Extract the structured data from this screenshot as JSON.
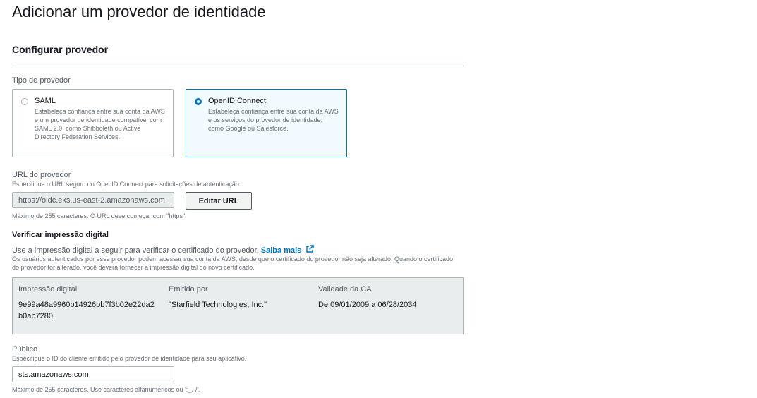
{
  "page": {
    "title": "Adicionar um provedor de identidade",
    "section_title": "Configurar provedor"
  },
  "provider_type": {
    "label": "Tipo de provedor",
    "options": [
      {
        "title": "SAML",
        "description": "Estabeleça confiança entre sua conta da AWS e um provedor de identidade compatível com SAML 2.0, como Shibboleth ou Active Directory Federation Services.",
        "selected": false
      },
      {
        "title": "OpenID Connect",
        "description": "Estabeleça confiança entre sua conta da AWS e os serviços do provedor de identidade, como Google ou Salesforce.",
        "selected": true
      }
    ]
  },
  "provider_url": {
    "label": "URL do provedor",
    "hint": "Especifique o URL seguro do OpenID Connect para solicitações de autenticação.",
    "value": "https://oidc.eks.us-east-2.amazonaws.com",
    "edit_button": "Editar URL",
    "constraint": "Máximo de 255 caracteres. O URL deve começar com \"https\""
  },
  "thumbprint": {
    "title": "Verificar impressão digital",
    "description": "Use a impressão digital a seguir para verificar o certificado do provedor.",
    "learn_more": "Saiba mais",
    "hint": "Os usuários autenticados por esse provedor podem acessar sua conta da AWS, desde que o certificado do provedor não seja alterado. Quando o certificado do provedor for alterado, você deverá fornecer a impressão digital do novo certificado.",
    "columns": [
      "Impressão digital",
      "Emitido por",
      "Validade da CA"
    ],
    "row": {
      "fingerprint_line1": "9e99a48a9960b14926bb7f3b02e22da2",
      "fingerprint_line2": "b0ab7280",
      "issuer": "\"Starfield Technologies, Inc.\"",
      "validity": "De 09/01/2009 a 06/28/2034"
    }
  },
  "audience": {
    "label": "Público",
    "hint": "Especifique o ID do cliente emitido pelo provedor de identidade para seu aplicativo.",
    "value": "sts.amazonaws.com",
    "constraint": "Máximo de 255 caracteres. Use caracteres alfanuméricos ou ':_.-/'."
  },
  "colors": {
    "accent": "#0073bb",
    "selected_bg": "#f1faff",
    "table_bg": "#eaeded"
  },
  "icons": {
    "learn_more": "external-link-icon"
  }
}
